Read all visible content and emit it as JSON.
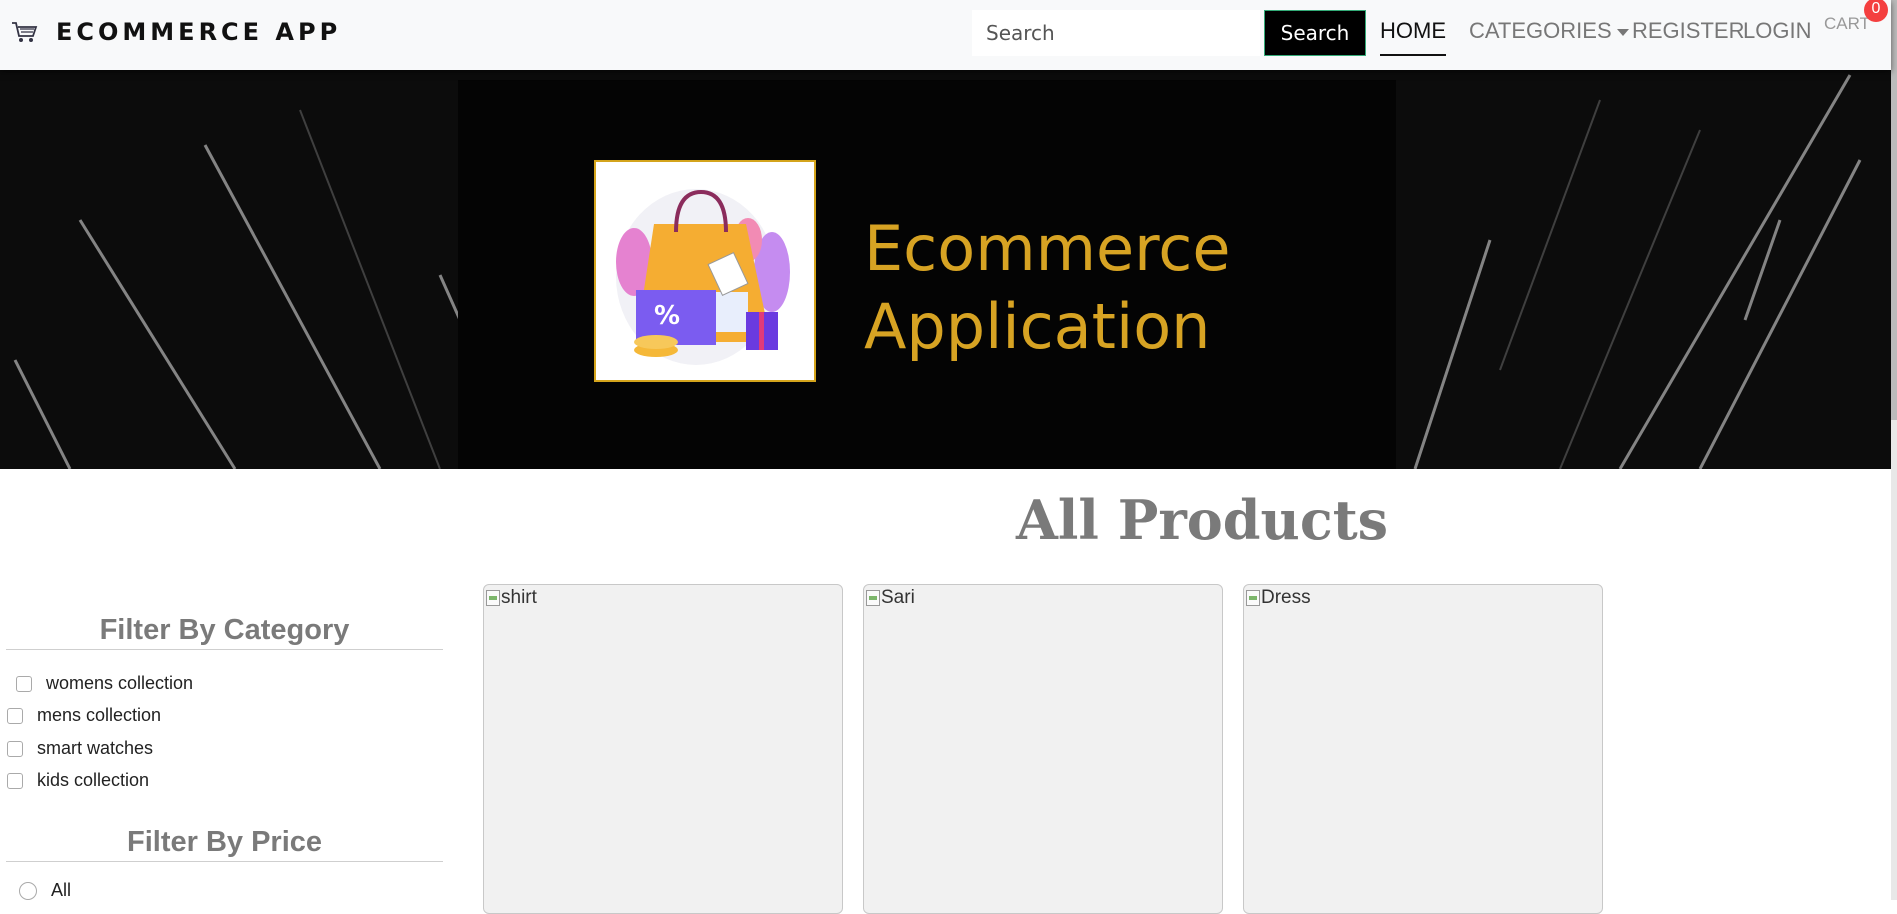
{
  "navbar": {
    "brand": "ECOMMERCE APP",
    "brand_icon": "shopping-cart-icon",
    "search_placeholder": "Search",
    "search_button": "Search",
    "links": {
      "home": "HOME",
      "categories": "CATEGORIES",
      "register": "REGISTER",
      "login": "LOGIN",
      "cart": "CART"
    },
    "cart_count": "0"
  },
  "banner": {
    "line1": "Ecommerce",
    "line2": "Application",
    "logo_icon": "shopping-bag-icon",
    "text_color": "#d7a323"
  },
  "main": {
    "title": "All Products"
  },
  "filters": {
    "category_title": "Filter By Category",
    "categories": [
      "womens collection",
      "mens collection",
      "smart watches",
      "kids collection"
    ],
    "price_title": "Filter By Price",
    "price_options": [
      "All"
    ]
  },
  "products": [
    {
      "alt": "shirt"
    },
    {
      "alt": "Sari"
    },
    {
      "alt": "Dress"
    }
  ],
  "colors": {
    "accent": "#000000",
    "badge": "#f43f3f",
    "heading": "#7a7a7a"
  }
}
